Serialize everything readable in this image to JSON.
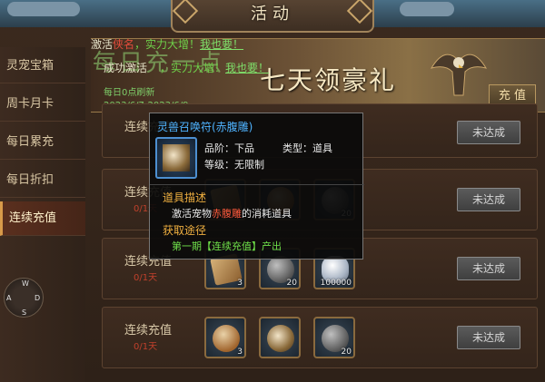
{
  "header": {
    "title": "活动"
  },
  "sidebar": {
    "items": [
      {
        "label": "灵宠宝箱",
        "active": false
      },
      {
        "label": "周卡月卡",
        "active": false
      },
      {
        "label": "每日累充",
        "active": false
      },
      {
        "label": "每日折扣",
        "active": false
      },
      {
        "label": "连续充值",
        "active": true
      }
    ]
  },
  "notices": [
    {
      "prefix": "激活",
      "hl": "侠名",
      "mid": "，实力大增！",
      "link": "我也要！"
    },
    {
      "prefix": "成功激活",
      "hl": "",
      "mid": "，实力大增！",
      "link": "我也要！"
    }
  ],
  "banner": {
    "title_bg": "每日充一点",
    "title_main": "七天领豪礼",
    "daily": "每日0点刷新",
    "date": "2023/6/7-2023/6/9",
    "recharge_label": "充 值"
  },
  "rows": [
    {
      "label": "连续充值",
      "sub": "",
      "items": [],
      "button": "未达成"
    },
    {
      "label": "连续充值",
      "sub": "0/1天",
      "items": [
        {
          "icon": "scroll-item",
          "qty": ""
        },
        {
          "icon": "egg-item",
          "qty": ""
        },
        {
          "icon": "stone-item",
          "qty": "20"
        }
      ],
      "button": "未达成"
    },
    {
      "label": "连续充值",
      "sub": "0/1天",
      "items": [
        {
          "icon": "scroll-item",
          "qty": "3"
        },
        {
          "icon": "stone-item",
          "qty": "20"
        },
        {
          "icon": "silver-item",
          "qty": "100000"
        }
      ],
      "button": "未达成"
    },
    {
      "label": "连续充值",
      "sub": "0/1天",
      "items": [
        {
          "icon": "egg-item",
          "qty": "3"
        },
        {
          "icon": "bird-item",
          "qty": ""
        },
        {
          "icon": "stone-item",
          "qty": "20"
        }
      ],
      "button": "未达成"
    }
  ],
  "tooltip": {
    "name": "灵兽召唤符(赤腹雕)",
    "grade_label": "品阶：下品",
    "type_label": "类型：道具",
    "level_label": "等级：无限制",
    "desc_head": "道具描述",
    "desc_pre": "激活宠物",
    "desc_hl": "赤腹雕",
    "desc_post": "的消耗道具",
    "src_head": "获取途径",
    "src_body": "第一期【连续充值】产出"
  },
  "compass": {
    "n": "W",
    "e": "D",
    "s": "S",
    "w": "A"
  },
  "colors": {
    "accent": "#d89a4a",
    "link": "#7fe06a",
    "warn": "#c0402c",
    "tooltip_name": "#4fb3ff"
  }
}
